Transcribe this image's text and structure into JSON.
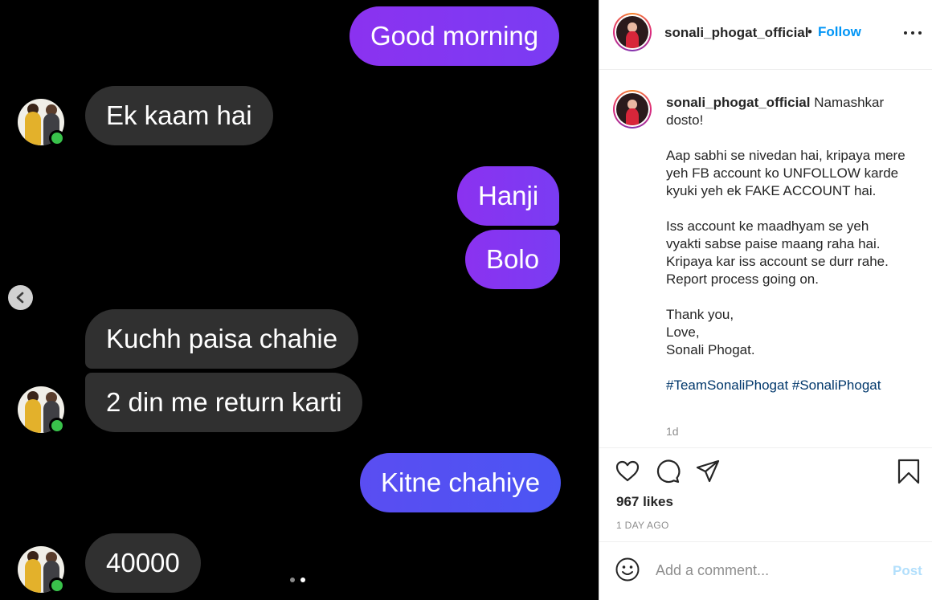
{
  "messages": [
    {
      "text": "Good morning",
      "direction": "out"
    },
    {
      "text": "Ek kaam hai",
      "direction": "in"
    },
    {
      "text": "Hanji",
      "direction": "out"
    },
    {
      "text": "Bolo",
      "direction": "out"
    },
    {
      "text": "Kuchh paisa chahie",
      "direction": "in"
    },
    {
      "text": "2 din me return karti",
      "direction": "in"
    },
    {
      "text": "Kitne chahiye",
      "direction": "out"
    },
    {
      "text": "40000",
      "direction": "in"
    }
  ],
  "carousel": {
    "total_slides": 2,
    "active_slide": 2
  },
  "header": {
    "username": "sonali_phogat_official",
    "separator": "•",
    "follow_label": "Follow"
  },
  "caption": {
    "username": "sonali_phogat_official",
    "lines": [
      "Namashkar dosto!",
      "Aap sabhi se nivedan hai, kripaya mere yeh FB account ko UNFOLLOW karde kyuki yeh ek FAKE ACCOUNT hai.",
      "Iss account ke maadhyam se yeh vyakti sabse paise maang raha hai. Kripaya kar iss account se durr rahe. Report process going on.",
      "Thank you,",
      "Love,",
      "Sonali Phogat.",
      "#TeamSonaliPhogat #SonaliPhogat"
    ],
    "time_ago": "1d"
  },
  "actions": {
    "icons": [
      "heart-icon",
      "comment-icon",
      "share-icon",
      "bookmark-icon"
    ]
  },
  "likes": "967 likes",
  "date_label": "1 DAY AGO",
  "comment_box": {
    "placeholder": "Add a comment...",
    "post_label": "Post"
  },
  "colors": {
    "follow": "#0095f6",
    "post_disabled": "#b2dffc",
    "bubble_outgoing": "#8b32f0",
    "bubble_incoming": "#303030",
    "online": "#39c24b"
  }
}
